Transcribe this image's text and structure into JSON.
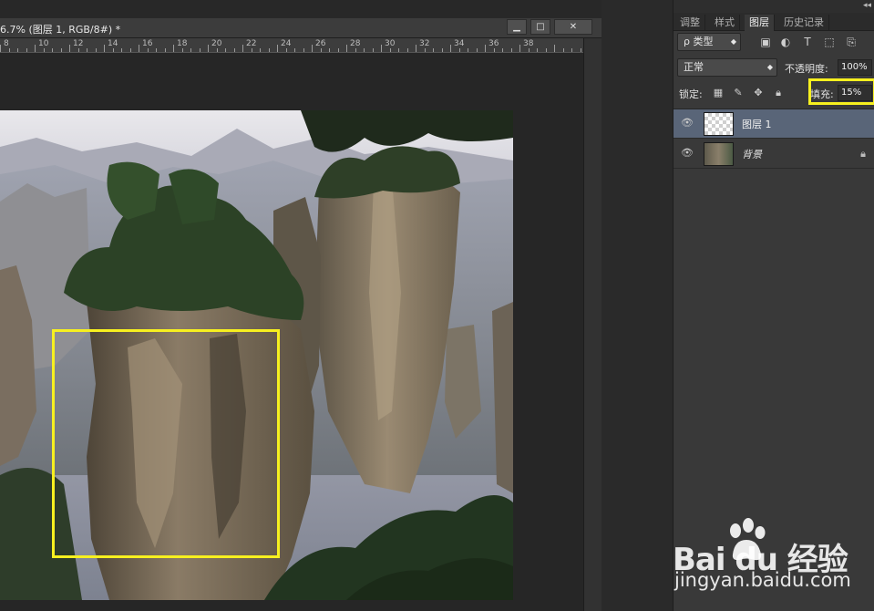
{
  "document": {
    "title": "6.7% (图层 1, RGB/8#) *",
    "window_buttons": {
      "minimize": "▁",
      "maximize": "□",
      "close": "✕"
    },
    "ruler_ticks": [
      "8",
      "10",
      "12",
      "14",
      "16",
      "18",
      "20",
      "22",
      "24",
      "26",
      "28",
      "30",
      "32",
      "34",
      "36",
      "38"
    ]
  },
  "panel": {
    "tabs": [
      {
        "label": "调整",
        "active": false
      },
      {
        "label": "样式",
        "active": false
      },
      {
        "label": "图层",
        "active": true
      },
      {
        "label": "历史记录",
        "active": false
      }
    ],
    "filter": {
      "kind_label": "ρ 类型",
      "icons": [
        "image-filter-icon",
        "adjustment-filter-icon",
        "type-filter-icon",
        "shape-filter-icon",
        "smart-object-filter-icon"
      ]
    },
    "blend_mode": "正常",
    "opacity_label": "不透明度:",
    "opacity_value": "100%",
    "lock_label": "锁定:",
    "fill_label": "填充:",
    "fill_value": "15%",
    "layers": [
      {
        "name": "图层 1",
        "selected": true,
        "visible": true,
        "locked": false
      },
      {
        "name": "背景",
        "selected": false,
        "visible": true,
        "locked": true
      }
    ]
  },
  "watermark": {
    "logo": "Bai  du",
    "logo_cn": "经验",
    "url": "jingyan.baidu.com"
  },
  "colors": {
    "highlight": "#f7f01f",
    "selected_layer": "#596578",
    "panel_bg": "#393939"
  }
}
